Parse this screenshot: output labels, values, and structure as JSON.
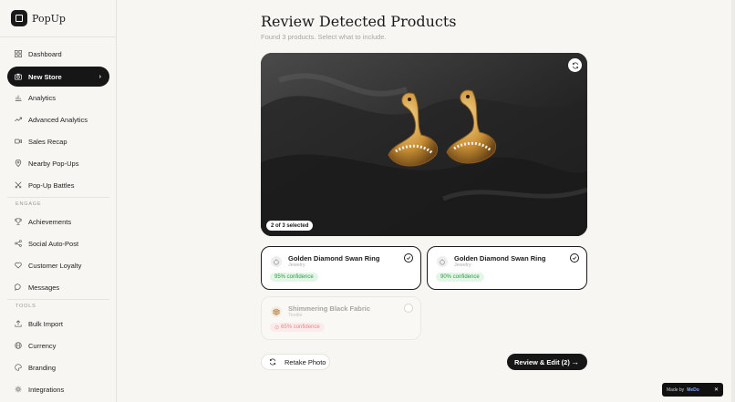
{
  "app": {
    "name": "PopUp"
  },
  "sidebar": {
    "items": [
      {
        "label": "Dashboard",
        "icon": "grid-icon"
      },
      {
        "label": "New Store",
        "icon": "camera-icon",
        "active": true
      },
      {
        "label": "Analytics",
        "icon": "bar-chart-icon"
      },
      {
        "label": "Advanced Analytics",
        "icon": "trend-icon"
      },
      {
        "label": "Sales Recap",
        "icon": "video-icon"
      },
      {
        "label": "Nearby Pop-Ups",
        "icon": "map-pin-icon"
      },
      {
        "label": "Pop-Up Battles",
        "icon": "swords-icon"
      }
    ],
    "engage_label": "ENGAGE",
    "engage_items": [
      {
        "label": "Achievements",
        "icon": "trophy-icon"
      },
      {
        "label": "Social Auto-Post",
        "icon": "share-icon"
      },
      {
        "label": "Customer Loyalty",
        "icon": "heart-icon"
      },
      {
        "label": "Messages",
        "icon": "chat-icon"
      }
    ],
    "tools_label": "TOOLS",
    "tools_items": [
      {
        "label": "Bulk Import",
        "icon": "upload-icon"
      },
      {
        "label": "Currency",
        "icon": "globe-icon"
      },
      {
        "label": "Branding",
        "icon": "palette-icon"
      },
      {
        "label": "Integrations",
        "icon": "plug-icon"
      }
    ]
  },
  "main": {
    "title": "Review Detected Products",
    "subtitle": "Found 3 products. Select what to include.",
    "selection_badge": "2 of 3 selected",
    "products": [
      {
        "name": "Golden Diamond Swan Ring",
        "category": "Jewelry",
        "confidence": "95% confidence",
        "selected": true
      },
      {
        "name": "Golden Diamond Swan Ring",
        "category": "Jewelry",
        "confidence": "90% confidence",
        "selected": true
      },
      {
        "name": "Shimmering Black Fabric",
        "category": "Textile",
        "confidence": "65% confidence",
        "selected": false
      }
    ],
    "retake_label": "Retake Photo",
    "review_label": "Review & Edit (2)"
  },
  "footer": {
    "made_by": "Made by",
    "brand": "MeDo"
  },
  "colors": {
    "accent": "#161616",
    "high_conf": "#2f9a47",
    "low_conf": "#e05858"
  }
}
